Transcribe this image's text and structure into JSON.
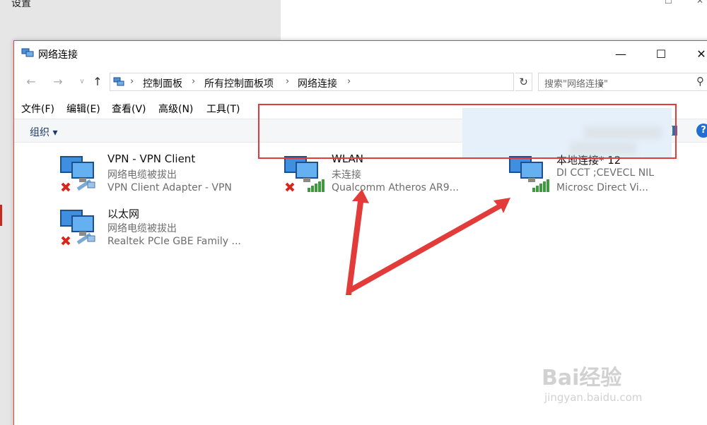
{
  "background_window": {
    "title": "设置"
  },
  "window": {
    "title": "网络连接",
    "controls": {
      "minimize": "—",
      "maximize": "☐",
      "close": "✕"
    }
  },
  "address_bar": {
    "breadcrumbs": [
      "控制面板",
      "所有控制面板项",
      "网络连接"
    ],
    "search_placeholder": "搜索\"网络连接\""
  },
  "menu": [
    "文件(F)",
    "编辑(E)",
    "查看(V)",
    "高级(N)",
    "工具(T)"
  ],
  "toolbar": {
    "organize_label": "组织 ▾",
    "help_label": "?"
  },
  "connections": [
    {
      "name": "VPN - VPN Client",
      "status": "网络电缆被拔出",
      "adapter": "VPN Client Adapter - VPN",
      "icon": "wired-disconnected-icon"
    },
    {
      "name": "以太网",
      "status": "网络电缆被拔出",
      "adapter": "Realtek PCIe GBE Family ...",
      "icon": "wired-disconnected-icon"
    },
    {
      "name": "WLAN",
      "status": "未连接",
      "adapter": "Qualcomm Atheros AR9...",
      "icon": "wifi-disconnected-icon"
    },
    {
      "name": "本地连接* 12",
      "status": "DI    CCT   ;CEVECL    NIL",
      "adapter": "Microsc            Direct Vi...",
      "icon": "wifi-connected-icon"
    }
  ],
  "annotation": {
    "color": "#e33a3a"
  },
  "watermark": {
    "main": "Bai经验",
    "sub": "jingyan.baidu.com"
  }
}
